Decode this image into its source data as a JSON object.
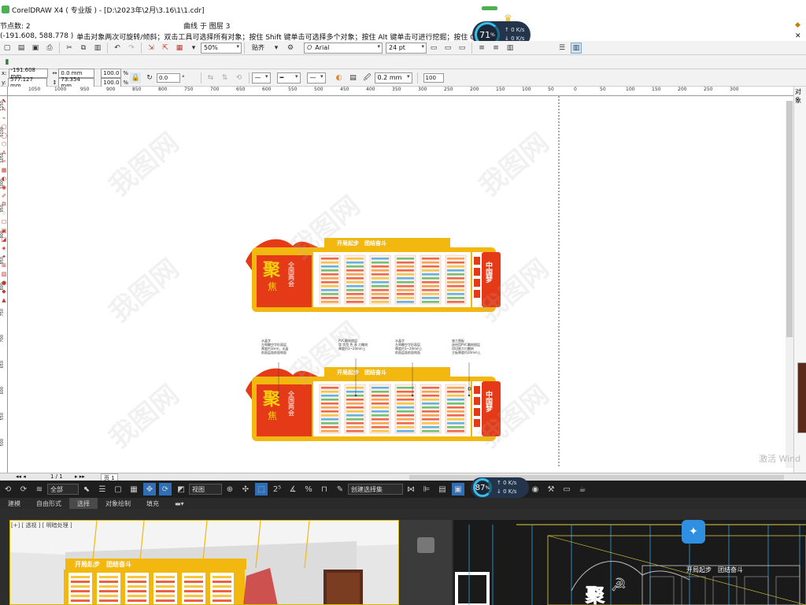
{
  "app": {
    "title": "CorelDRAW X4 ( 专业版 ) - [D:\\2023年\\2月\\3.16\\1\\1.cdr]",
    "status_left": "节点数: 2",
    "status_center": "曲线 于 图层 3",
    "coords": "(-191.608, 588.778 )",
    "hint": "单击对象两次可旋转/倾斜；双击工具可选择所有对象；按住 Shift 键单击可选择多个对象；按住 Alt 键单击可进行挖掘；按住 Ctrl 并单..."
  },
  "standard_toolbar": {
    "zoom": "50%",
    "snap_label": "贴齐",
    "font_name": "Arial",
    "font_size": "24 pt"
  },
  "property_bar": {
    "x_label": "x:",
    "x": "-191.608 mm",
    "y_label": "y:",
    "y": "577.127 mm",
    "width": "0.0 mm",
    "height": "73.354 mm",
    "scale_x": "100.0",
    "scale_y": "100.0",
    "pct": "%",
    "angle": "0.0",
    "angle_unit": "°",
    "outline_width": "0.2 mm",
    "smoothing": "100"
  },
  "ruler": {
    "top_ticks": [
      "1050",
      "1000",
      "950",
      "900",
      "850",
      "800",
      "750",
      "700",
      "650",
      "600",
      "550",
      "500",
      "450",
      "400",
      "350",
      "300",
      "250",
      "200",
      "150",
      "100",
      "50",
      "0",
      "50",
      "100",
      "150",
      "200",
      "250",
      "300"
    ],
    "left_ticks": [
      "1150",
      "1100",
      "1050",
      "1000",
      "950",
      "900",
      "850",
      "800",
      "750",
      "700",
      "650",
      "600",
      "550",
      "500"
    ]
  },
  "network_widget_top": {
    "percent": "71",
    "unit": "%",
    "up": "0",
    "up_unit": "K/s",
    "down": "0",
    "down_unit": "K/s"
  },
  "network_widget_bottom": {
    "percent": "87",
    "unit": "%",
    "up": "0",
    "up_unit": "K/s",
    "down": "0",
    "down_unit": "K/s"
  },
  "page_nav": {
    "text": "1 / 1",
    "page_tab": "页 1"
  },
  "watermark_os": "激活 Wind",
  "docker_label": "对象",
  "design_board": {
    "banner": "开局起步　团结奋斗",
    "big_char": "聚",
    "vertical_char": "焦",
    "title_words": "全国两会",
    "right_panel": "中国梦",
    "red": "#e53a17",
    "yellow": "#f2b80f"
  },
  "annotations": [
    {
      "lines": [
        "水晶字",
        "左侧雕空字形面层",
        "厚度约3mm，水晶",
        "前面层面前面侧面"
      ]
    },
    {
      "lines": [
        "PVC雕刻图层",
        "背 切型 色 表 刀雕刻",
        "厚度约3~20mm上"
      ]
    },
    {
      "lines": [
        "水晶字",
        "左侧雕空字形面层",
        "厚度约3~20mm上",
        "前面层面前面侧面"
      ]
    },
    {
      "lines": [
        "施工图板",
        "选材用PVC雕刻图层",
        "用切割刀刀雕刻",
        "主板厚度约20mm上"
      ]
    }
  ],
  "max": {
    "layer_dropdown": "全部",
    "view_dropdown": "视图",
    "selection_set": "创建选择集",
    "tabs": [
      "建模",
      "自由形式",
      "选择",
      "对象绘制",
      "填充"
    ],
    "active_tab": "选择",
    "viewport_label": "[+] [ 透视 ] [ 明暗处理 ]",
    "viewport_banner": "开局起步　团结奋斗",
    "wire_banner": "开局起步　团结奋斗"
  }
}
